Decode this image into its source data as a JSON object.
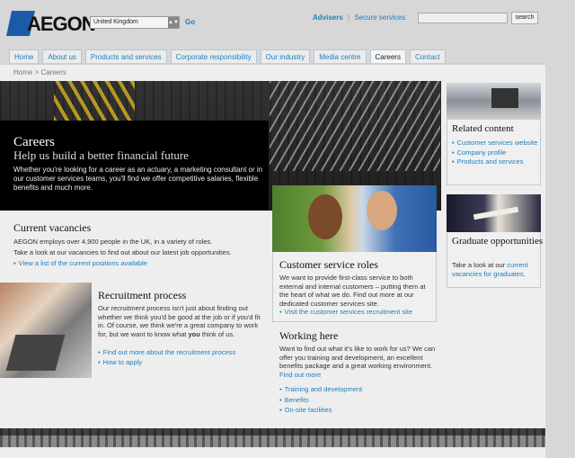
{
  "header": {
    "logo_text": "AEGON",
    "country_select": "United Kingdom",
    "go_label": "Go",
    "advisers_link": "Advisers",
    "separator": "|",
    "secure_link": "Secure services",
    "search_button": "search"
  },
  "nav": {
    "tabs": [
      {
        "label": "Home"
      },
      {
        "label": "About us"
      },
      {
        "label": "Products and services"
      },
      {
        "label": "Corporate responsibility"
      },
      {
        "label": "Our industry"
      },
      {
        "label": "Media centre"
      },
      {
        "label": "Careers"
      },
      {
        "label": "Contact"
      }
    ],
    "active": "Careers"
  },
  "breadcrumb": "Home > Careers",
  "hero": {
    "title": "Careers",
    "subtitle": "Help us build a better financial future",
    "text": "Whether you're looking for a career as an actuary, a marketing consultant or in our customer services teams, you'll find we offer competitive salaries, flexible benefits and much more."
  },
  "current_vacancies": {
    "title": "Current vacancies",
    "p1": "AEGON employs over 4,900 people in the UK, in a variety of roles.",
    "p2": "Take a look at our vacancies to find out about our latest job opportunities.",
    "link": "View a list of the current positions available"
  },
  "recruitment": {
    "title": "Recruitment process",
    "text_before": "Our recruitment process isn't just about finding out whether we think you'd be good at the job or if you'd fit in. Of course, we think we're a great company to work for, but we want to know what ",
    "text_bold": "you",
    "text_after": " think of us.",
    "link1": "Find out more about the recruitment process",
    "link2": "How to apply"
  },
  "customer_service": {
    "title": "Customer service roles",
    "text": "We want to provide first-class service to both external and internal customers – putting them at the heart of what we do. Find out more at our dedicated customer services site.",
    "link": "Visit the customer services recruitment site"
  },
  "working_here": {
    "title": "Working here",
    "text": "Want to find out what it's like to work for us? We can offer you training and development, an excellent benefits package and a great working environment.",
    "find_more": "Find out more",
    "links": [
      "Training and development",
      "Benefits",
      "On-site facilities"
    ]
  },
  "related": {
    "title": "Related content",
    "items": [
      "Customer services website",
      "Company profile",
      "Products and services"
    ]
  },
  "graduate": {
    "title": "Graduate opportunities",
    "text_before": "Take a look at our ",
    "link": "current vacancies for graduates",
    "text_after": "."
  },
  "icons": {
    "bullet": "▪",
    "dropdown": "▲▼"
  },
  "colors": {
    "link": "#1a7fc0",
    "brand": "#1b5aa8"
  }
}
